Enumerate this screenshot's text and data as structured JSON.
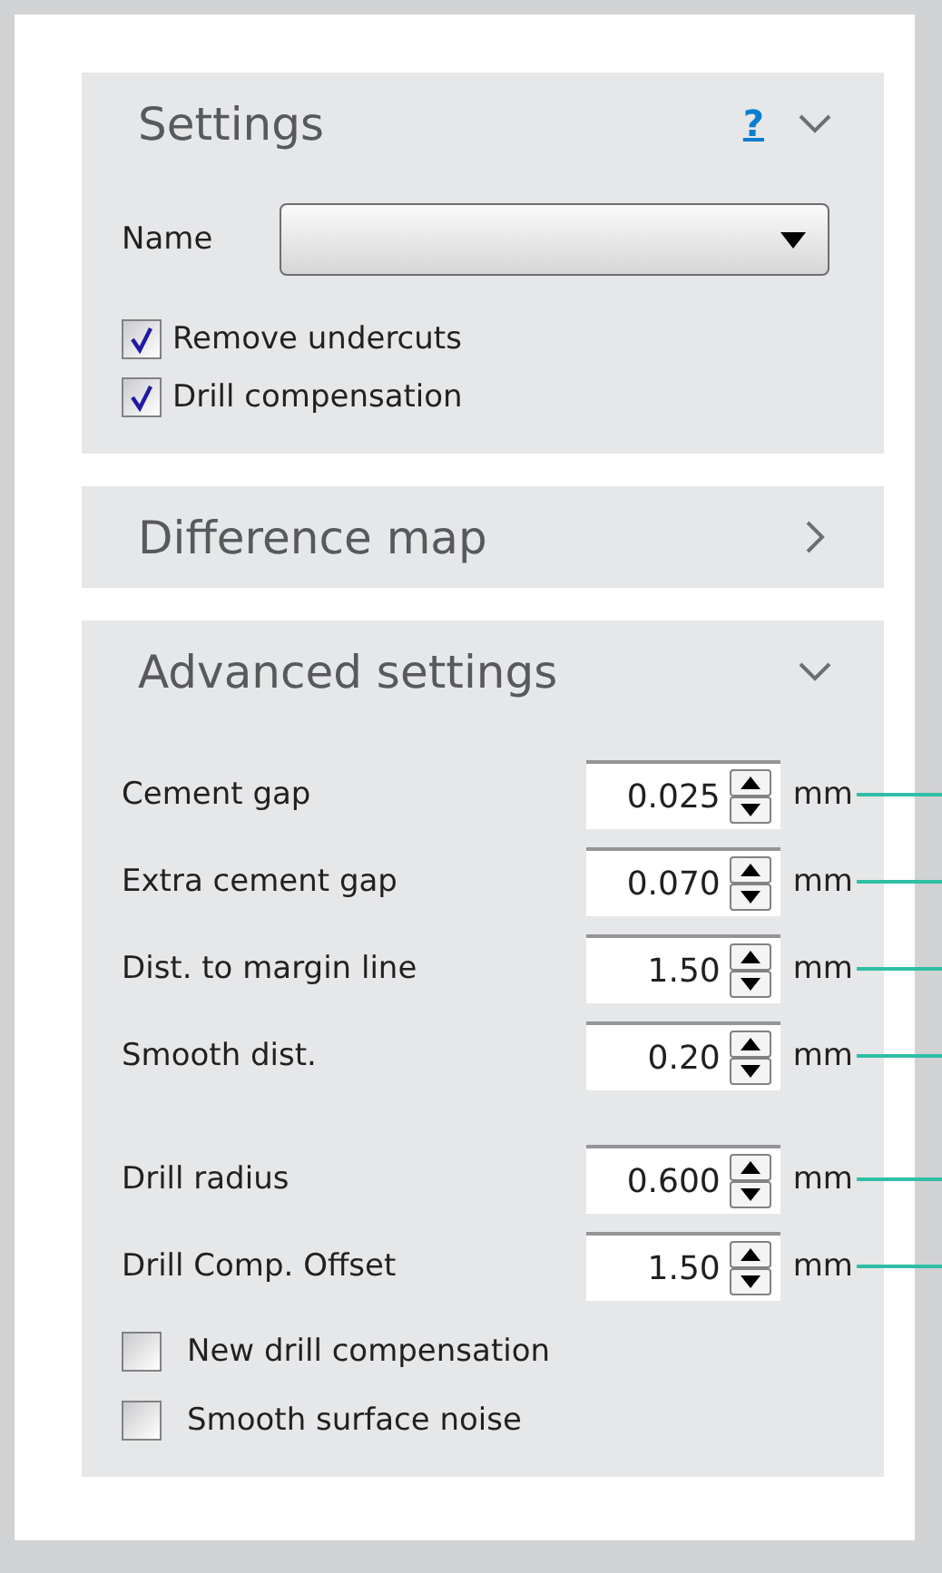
{
  "sections": [
    {
      "title": "Settings",
      "expanded": true,
      "help": "?",
      "name_field": {
        "label": "Name"
      },
      "options": [
        {
          "label": "Remove undercuts",
          "checked": true
        },
        {
          "label": "Drill compensation",
          "checked": true
        }
      ]
    },
    {
      "title": "Difference map",
      "expanded": false
    },
    {
      "title": "Advanced settings",
      "expanded": true,
      "field_groups": [
        [
          {
            "label": "Cement gap",
            "value": "0.025",
            "unit": "mm"
          },
          {
            "label": "Extra cement gap",
            "value": "0.070",
            "unit": "mm"
          },
          {
            "label": "Dist. to margin line",
            "value": "1.50",
            "unit": "mm"
          },
          {
            "label": "Smooth dist.",
            "value": "0.20",
            "unit": "mm"
          }
        ],
        [
          {
            "label": "Drill radius",
            "value": "0.600",
            "unit": "mm"
          },
          {
            "label": "Drill Comp. Offset",
            "value": "1.50",
            "unit": "mm"
          }
        ]
      ],
      "options": [
        {
          "label": "New drill compensation",
          "checked": false
        },
        {
          "label": "Smooth surface noise",
          "checked": false
        }
      ]
    }
  ]
}
